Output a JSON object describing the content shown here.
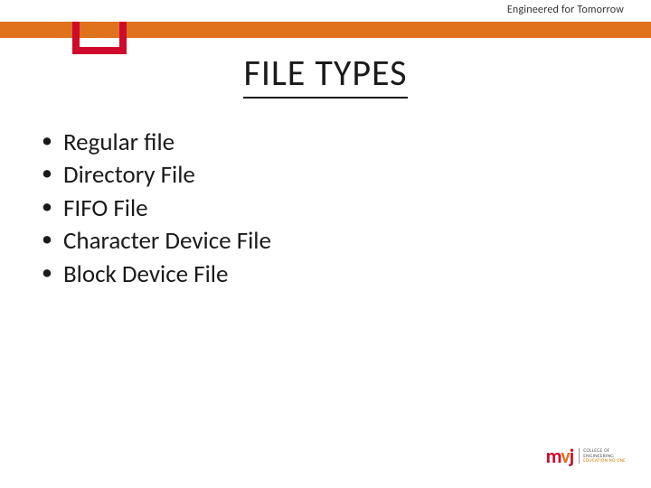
{
  "header": {
    "tagline": "Engineered for Tomorrow"
  },
  "title": "FILE TYPES",
  "bullets": [
    "Regular file",
    "Directory File",
    "FIFO File",
    "Character Device File",
    "Block Device File"
  ],
  "logo": {
    "mark_m": "m",
    "mark_v": "v",
    "mark_j": "j",
    "line1": "COLLEGE OF",
    "line2": "ENGINEERING",
    "sub": "EDUCATION NO ONE"
  },
  "colors": {
    "orange": "#e0721e",
    "red": "#cf0a2c"
  }
}
